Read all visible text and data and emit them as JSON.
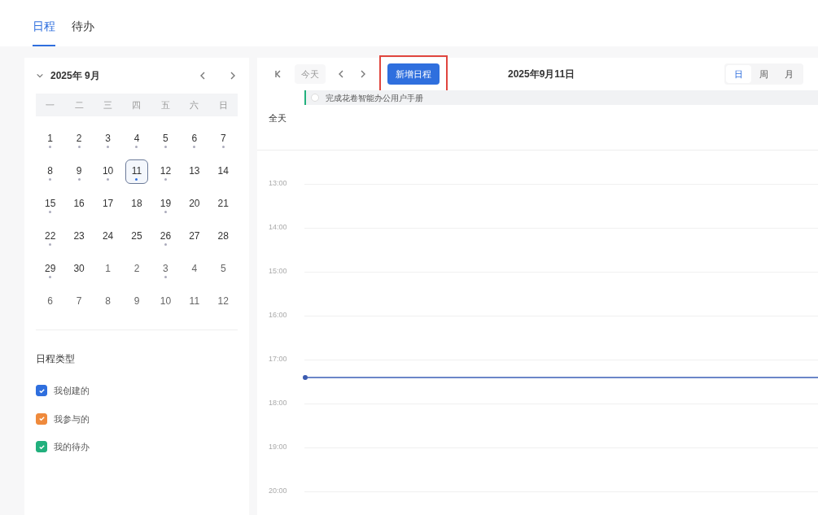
{
  "tabs": [
    {
      "label": "日程",
      "selected": true
    },
    {
      "label": "待办",
      "selected": false
    }
  ],
  "mini_calendar": {
    "title": "2025年 9月",
    "expanded": true,
    "weekdays": [
      "一",
      "二",
      "三",
      "四",
      "五",
      "六",
      "日"
    ],
    "days": [
      {
        "label": "1",
        "dot": true,
        "outside": false,
        "selected": false
      },
      {
        "label": "2",
        "dot": true,
        "outside": false,
        "selected": false
      },
      {
        "label": "3",
        "dot": true,
        "outside": false,
        "selected": false
      },
      {
        "label": "4",
        "dot": true,
        "outside": false,
        "selected": false
      },
      {
        "label": "5",
        "dot": true,
        "outside": false,
        "selected": false
      },
      {
        "label": "6",
        "dot": true,
        "outside": false,
        "selected": false
      },
      {
        "label": "7",
        "dot": true,
        "outside": false,
        "selected": false
      },
      {
        "label": "8",
        "dot": true,
        "outside": false,
        "selected": false
      },
      {
        "label": "9",
        "dot": true,
        "outside": false,
        "selected": false
      },
      {
        "label": "10",
        "dot": true,
        "outside": false,
        "selected": false
      },
      {
        "label": "11",
        "dot": true,
        "outside": false,
        "selected": true
      },
      {
        "label": "12",
        "dot": true,
        "outside": false,
        "selected": false
      },
      {
        "label": "13",
        "dot": false,
        "outside": false,
        "selected": false
      },
      {
        "label": "14",
        "dot": false,
        "outside": false,
        "selected": false
      },
      {
        "label": "15",
        "dot": true,
        "outside": false,
        "selected": false
      },
      {
        "label": "16",
        "dot": false,
        "outside": false,
        "selected": false
      },
      {
        "label": "17",
        "dot": false,
        "outside": false,
        "selected": false
      },
      {
        "label": "18",
        "dot": false,
        "outside": false,
        "selected": false
      },
      {
        "label": "19",
        "dot": true,
        "outside": false,
        "selected": false
      },
      {
        "label": "20",
        "dot": false,
        "outside": false,
        "selected": false
      },
      {
        "label": "21",
        "dot": false,
        "outside": false,
        "selected": false
      },
      {
        "label": "22",
        "dot": true,
        "outside": false,
        "selected": false
      },
      {
        "label": "23",
        "dot": false,
        "outside": false,
        "selected": false
      },
      {
        "label": "24",
        "dot": false,
        "outside": false,
        "selected": false
      },
      {
        "label": "25",
        "dot": false,
        "outside": false,
        "selected": false
      },
      {
        "label": "26",
        "dot": true,
        "outside": false,
        "selected": false
      },
      {
        "label": "27",
        "dot": false,
        "outside": false,
        "selected": false
      },
      {
        "label": "28",
        "dot": false,
        "outside": false,
        "selected": false
      },
      {
        "label": "29",
        "dot": true,
        "outside": false,
        "selected": false
      },
      {
        "label": "30",
        "dot": false,
        "outside": false,
        "selected": false
      },
      {
        "label": "1",
        "dot": false,
        "outside": true,
        "selected": false
      },
      {
        "label": "2",
        "dot": false,
        "outside": true,
        "selected": false
      },
      {
        "label": "3",
        "dot": true,
        "outside": true,
        "selected": false
      },
      {
        "label": "4",
        "dot": false,
        "outside": true,
        "selected": false
      },
      {
        "label": "5",
        "dot": false,
        "outside": true,
        "selected": false
      },
      {
        "label": "6",
        "dot": false,
        "outside": true,
        "selected": false
      },
      {
        "label": "7",
        "dot": false,
        "outside": true,
        "selected": false
      },
      {
        "label": "8",
        "dot": false,
        "outside": true,
        "selected": false
      },
      {
        "label": "9",
        "dot": false,
        "outside": true,
        "selected": false
      },
      {
        "label": "10",
        "dot": false,
        "outside": true,
        "selected": false
      },
      {
        "label": "11",
        "dot": false,
        "outside": true,
        "selected": false
      },
      {
        "label": "12",
        "dot": false,
        "outside": true,
        "selected": false
      }
    ]
  },
  "schedule_types": {
    "title": "日程类型",
    "items": [
      {
        "label": "我创建的",
        "checked": true,
        "color": "#2f6fde"
      },
      {
        "label": "我参与的",
        "checked": true,
        "color": "#ef8a3c"
      },
      {
        "label": "我的待办",
        "checked": true,
        "color": "#22b07d"
      }
    ]
  },
  "toolbar": {
    "today": "今天",
    "new_button": {
      "label": "新增日程",
      "highlighted": true
    },
    "date": "2025年9月11日",
    "views": [
      {
        "label": "日",
        "selected": true
      },
      {
        "label": "周",
        "selected": false
      },
      {
        "label": "月",
        "selected": false
      }
    ]
  },
  "all_day": {
    "label": "全天",
    "events": [
      {
        "title": "完成花卷智能办公用户手册",
        "done": false,
        "color": "#22b07d"
      }
    ]
  },
  "hours": [
    "13:00",
    "14:00",
    "15:00",
    "16:00",
    "17:00",
    "18:00",
    "19:00",
    "20:00"
  ]
}
